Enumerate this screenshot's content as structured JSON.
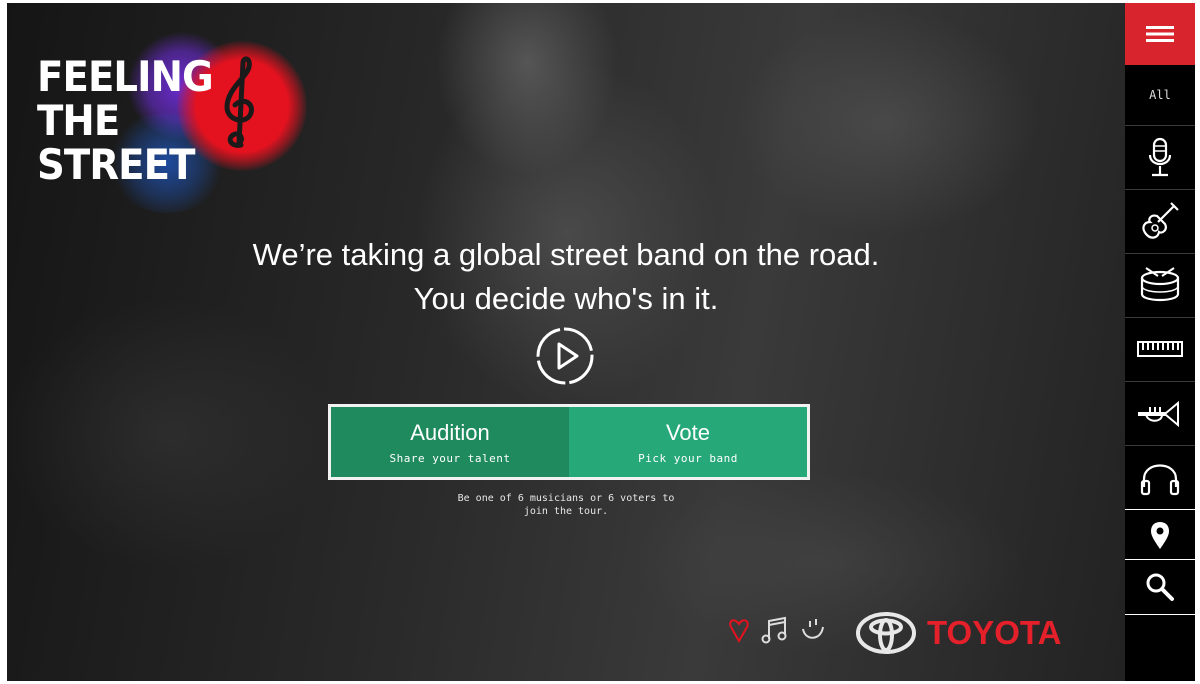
{
  "brand": {
    "logo_lines": [
      "FEELING",
      "THE",
      "STREET"
    ],
    "logo_colors": {
      "spray_red": "#e4121f",
      "spray_purple": "#6a2bd0",
      "spray_blue": "#1f5fd6"
    }
  },
  "hero": {
    "headline_line1": "We’re taking a global street band on the road.",
    "headline_line2": "You decide who's in it.",
    "play_icon": "play-circle-icon"
  },
  "cta": {
    "audition": {
      "title": "Audition",
      "subtitle": "Share your talent"
    },
    "vote": {
      "title": "Vote",
      "subtitle": "Pick your band"
    },
    "colors": {
      "audition": "#1f8a5e",
      "vote": "#27a878"
    }
  },
  "note": "Be one of 6 musicians or 6 voters to\njoin the tour.",
  "footer": {
    "icons": [
      "heart-icon",
      "music-notes-icon",
      "smile-icon"
    ],
    "sponsor": "TOYOTA",
    "sponsor_color": "#e4202b"
  },
  "sidebar": {
    "menu_icon": "hamburger-menu-icon",
    "menu_color": "#d8242d",
    "all_label": "All",
    "items": [
      "microphone-icon",
      "guitar-icon",
      "drum-icon",
      "keyboard-icon",
      "trumpet-icon",
      "headphones-icon",
      "location-pin-icon",
      "search-icon"
    ]
  }
}
